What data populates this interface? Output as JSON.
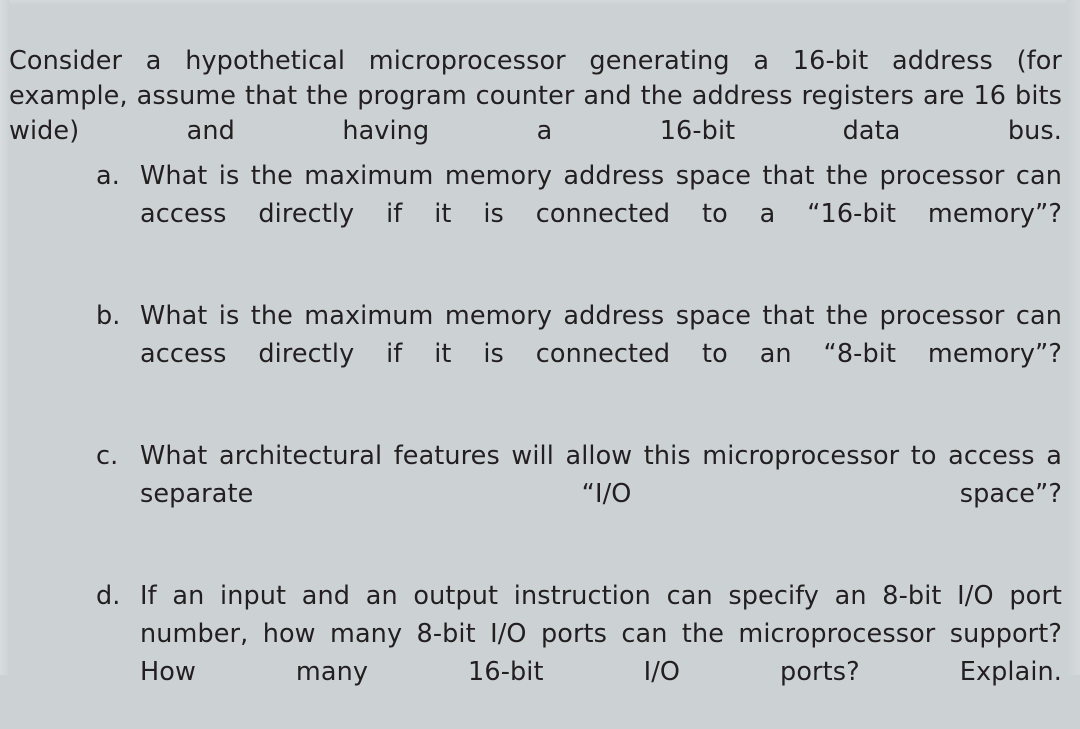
{
  "page": {
    "background_color": "#ccd2d4",
    "text_color": "#231f20",
    "intro": "Consider a hypothetical microprocessor generating a 16-bit address (for example, assume that the program counter and the address registers are 16 bits wide) and having a 16-bit data bus."
  },
  "questions": [
    {
      "marker": "a.",
      "text": "What is the maximum memory address space that the processor can access directly if it is connected to a “16-bit memory”?"
    },
    {
      "marker": "b.",
      "text": "What is the maximum memory address space that the processor can access directly if it is connected to an “8-bit memory”?"
    },
    {
      "marker": "c.",
      "text": "What architectural features will allow this microprocessor to access a separate “I/O space”?"
    },
    {
      "marker": "d.",
      "text": "If an input and an output instruction can specify an 8-bit I/O port number, how many 8-bit I/O ports can the microprocessor support? How many 16-bit I/O ports? Explain."
    }
  ]
}
